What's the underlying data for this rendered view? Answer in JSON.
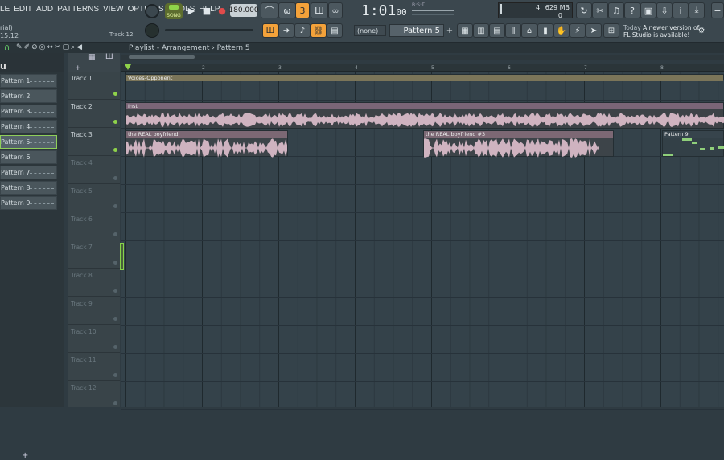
{
  "menu": [
    "LE",
    "EDIT",
    "ADD",
    "PATTERNS",
    "VIEW",
    "OPTIONS",
    "TOOLS",
    "HELP"
  ],
  "hint": {
    "line1": "rial)",
    "line2": "15:12",
    "track": "Track 12"
  },
  "transport": {
    "song_label": "SONG",
    "tempo": "180.000",
    "time_main": "1:01",
    "time_sub": "00",
    "time_unit": "B:S:T"
  },
  "cpu": {
    "value": "4",
    "memory": "629 MB",
    "voices": "0"
  },
  "snap": "(none)",
  "pattern_selector": "Pattern 5",
  "news": {
    "line1_prefix": "Today",
    "line1": "A newer version of",
    "line2": "FL Studio is available!"
  },
  "window_title": "Playlist - Arrangement › Pattern 5",
  "patterns": [
    "Pattern 1",
    "Pattern 2",
    "Pattern 3",
    "Pattern 4",
    "Pattern 5",
    "Pattern 6",
    "Pattern 7",
    "Pattern 8",
    "Pattern 9"
  ],
  "active_pattern": "Pattern 5",
  "tracks": [
    "Track 1",
    "Track 2",
    "Track 3",
    "Track 4",
    "Track 5",
    "Track 6",
    "Track 7",
    "Track 8",
    "Track 9",
    "Track 10",
    "Track 11",
    "Track 12"
  ],
  "ruler": [
    "2",
    "3",
    "4",
    "5",
    "6",
    "7",
    "8"
  ],
  "clips": {
    "voices": "Voices-Opponent",
    "inst": "Inst",
    "boy1": "the REAL boyfriend",
    "boy2": "the REAL boyfriend #3",
    "pat9": "Pattern 9"
  },
  "colors": {
    "accent": "#f4a23a",
    "green": "#8fd34a",
    "bg": "#34424a"
  }
}
